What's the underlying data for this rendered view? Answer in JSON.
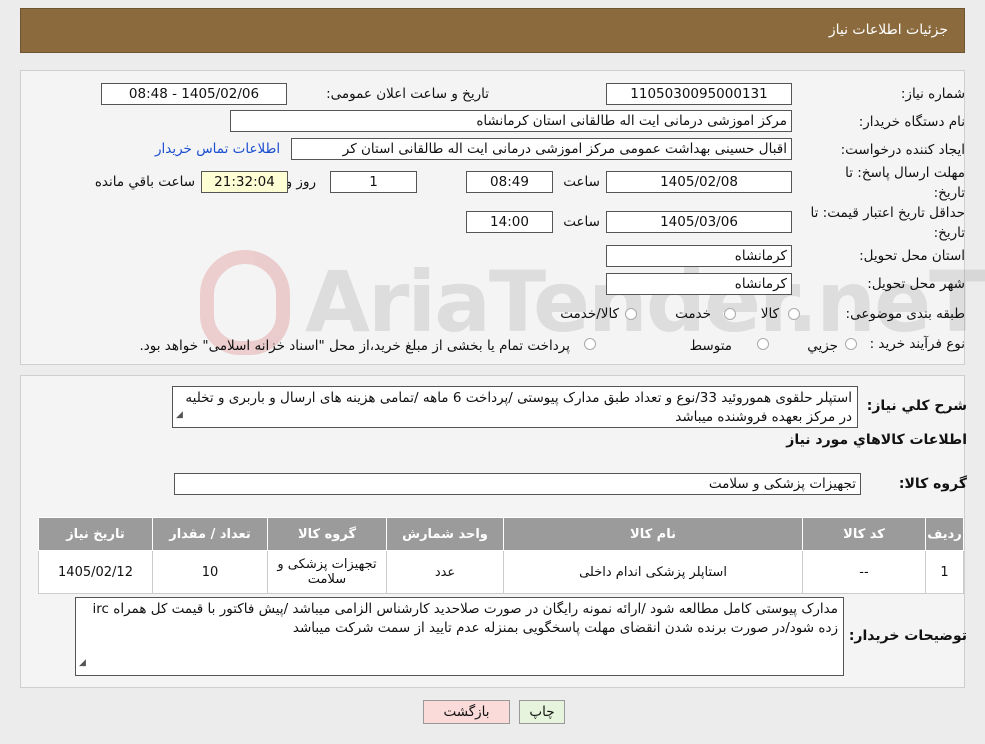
{
  "header": {
    "title": "جزئیات اطلاعات نیاز"
  },
  "watermark": {
    "text": "AriaTender.neT"
  },
  "form": {
    "need_number_label": "شماره نیاز:",
    "need_number": "1105030095000131",
    "announce_label": "تاریخ و ساعت اعلان عمومی:",
    "announce_value": "1405/02/06 - 08:48",
    "buyer_org_label": "نام دستگاه خریدار:",
    "buyer_org": "مرکز اموزشی درمانی ایت اله طالقانی استان کرمانشاه",
    "creator_label": "ایجاد کننده درخواست:",
    "creator": "اقبال حسینی بهداشت عمومی مرکز اموزشی درمانی ایت اله طالقانی استان کر",
    "contact_link": "اطلاعات تماس خریدار",
    "deadline_label": "مهلت ارسال پاسخ: تا تاریخ:",
    "deadline_date": "1405/02/08",
    "time_label": "ساعت",
    "deadline_time": "08:49",
    "days_value": "1",
    "days_label": "روز و",
    "remaining_time": "21:32:04",
    "remaining_label": "ساعت باقي مانده",
    "validity_label": "حداقل تاریخ اعتبار قیمت: تا تاریخ:",
    "validity_date": "1405/03/06",
    "validity_time": "14:00",
    "province_label": "استان محل تحویل:",
    "province": "کرمانشاه",
    "city_label": "شهر محل تحویل:",
    "city": "کرمانشاه",
    "category_label": "طبقه بندی موضوعی:",
    "category_options": [
      "کالا",
      "خدمت",
      "کالا/خدمت"
    ],
    "process_label": "نوع فرآیند خرید :",
    "process_options": [
      "جزیي",
      "متوسط"
    ],
    "process_note": "پرداخت تمام یا بخشی از مبلغ خرید،از محل \"اسناد خزانه اسلامی\" خواهد بود."
  },
  "summary": {
    "desc_label": "شرح کلي نياز:",
    "desc_text": "استپلر حلقوی هموروئید 33/نوع و تعداد طبق مدارک پیوستی /پرداخت 6 ماهه /تمامی هزینه های ارسال و باربری  و تخلیه در مرکز بعهده فروشنده میباشد",
    "goods_info_title": "اطلاعات کالاهاي مورد نياز",
    "goods_group_label": "گروه کالا:",
    "goods_group": "تجهیزات پزشکی و سلامت"
  },
  "table": {
    "headers": [
      "رديف",
      "کد کالا",
      "نام کالا",
      "واحد شمارش",
      "گروه کالا",
      "تعداد / مقدار",
      "تاريخ نياز"
    ],
    "rows": [
      [
        "1",
        "--",
        "استاپلر پزشکی اندام داخلی",
        "عدد",
        "تجهیزات پزشکی و سلامت",
        "10",
        "1405/02/12"
      ]
    ]
  },
  "buyer_notes": {
    "label": "توضیحات خریدار:",
    "text": "مدارک پیوستی کامل مطالعه شود /ارائه نمونه رایگان در صورت صلاحدید کارشناس الزامی میباشد /پیش فاکتور با قیمت کل همراه irc  زده شود/در صورت برنده شدن انقضای مهلت پاسخگویی بمنزله عدم تایید از سمت شرکت میباشد"
  },
  "buttons": {
    "print": "چاپ",
    "back": "بازگشت"
  }
}
